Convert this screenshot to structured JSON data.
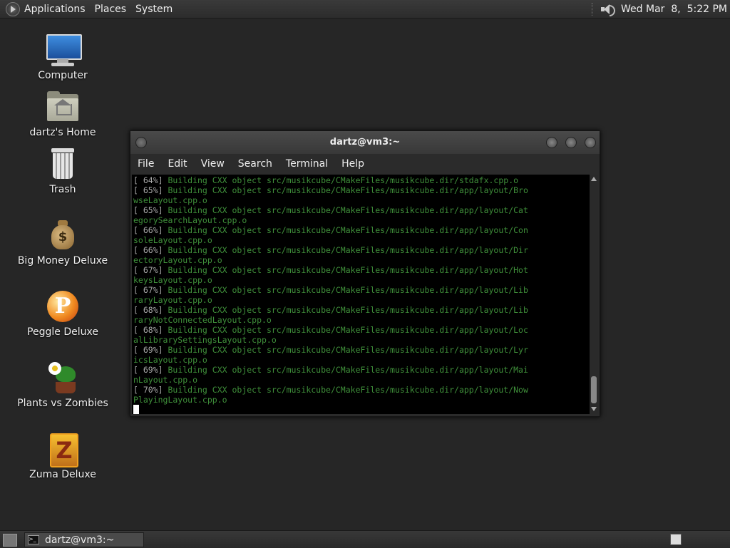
{
  "top_panel": {
    "menus": [
      "Applications",
      "Places",
      "System"
    ],
    "clock": "Wed Mar  8,  5:22 PM"
  },
  "desktop_icons": [
    {
      "label": "Computer",
      "icon": "computer-icon"
    },
    {
      "label": "dartz's Home",
      "icon": "home-folder-icon"
    },
    {
      "label": "Trash",
      "icon": "trash-icon"
    },
    {
      "label": "Big Money Deluxe",
      "icon": "money-bag-icon"
    },
    {
      "label": "Peggle Deluxe",
      "icon": "peggle-icon"
    },
    {
      "label": "Plants vs Zombies",
      "icon": "plants-icon"
    },
    {
      "label": "Zuma Deluxe",
      "icon": "zuma-icon"
    }
  ],
  "terminal": {
    "title": "dartz@vm3:~",
    "menu": [
      "File",
      "Edit",
      "View",
      "Search",
      "Terminal",
      "Help"
    ],
    "lines": [
      {
        "pct": "[ 64%]",
        "text": " Building CXX object src/musikcube/CMakeFiles/musikcube.dir/stdafx.cpp.o"
      },
      {
        "pct": "[ 65%]",
        "text": " Building CXX object src/musikcube/CMakeFiles/musikcube.dir/app/layout/Bro"
      },
      {
        "pct": "",
        "text": "wseLayout.cpp.o"
      },
      {
        "pct": "[ 65%]",
        "text": " Building CXX object src/musikcube/CMakeFiles/musikcube.dir/app/layout/Cat"
      },
      {
        "pct": "",
        "text": "egorySearchLayout.cpp.o"
      },
      {
        "pct": "[ 66%]",
        "text": " Building CXX object src/musikcube/CMakeFiles/musikcube.dir/app/layout/Con"
      },
      {
        "pct": "",
        "text": "soleLayout.cpp.o"
      },
      {
        "pct": "[ 66%]",
        "text": " Building CXX object src/musikcube/CMakeFiles/musikcube.dir/app/layout/Dir"
      },
      {
        "pct": "",
        "text": "ectoryLayout.cpp.o"
      },
      {
        "pct": "[ 67%]",
        "text": " Building CXX object src/musikcube/CMakeFiles/musikcube.dir/app/layout/Hot"
      },
      {
        "pct": "",
        "text": "keysLayout.cpp.o"
      },
      {
        "pct": "[ 67%]",
        "text": " Building CXX object src/musikcube/CMakeFiles/musikcube.dir/app/layout/Lib"
      },
      {
        "pct": "",
        "text": "raryLayout.cpp.o"
      },
      {
        "pct": "[ 68%]",
        "text": " Building CXX object src/musikcube/CMakeFiles/musikcube.dir/app/layout/Lib"
      },
      {
        "pct": "",
        "text": "raryNotConnectedLayout.cpp.o"
      },
      {
        "pct": "[ 68%]",
        "text": " Building CXX object src/musikcube/CMakeFiles/musikcube.dir/app/layout/Loc"
      },
      {
        "pct": "",
        "text": "alLibrarySettingsLayout.cpp.o"
      },
      {
        "pct": "[ 69%]",
        "text": " Building CXX object src/musikcube/CMakeFiles/musikcube.dir/app/layout/Lyr"
      },
      {
        "pct": "",
        "text": "icsLayout.cpp.o"
      },
      {
        "pct": "[ 69%]",
        "text": " Building CXX object src/musikcube/CMakeFiles/musikcube.dir/app/layout/Mai"
      },
      {
        "pct": "",
        "text": "nLayout.cpp.o"
      },
      {
        "pct": "[ 70%]",
        "text": " Building CXX object src/musikcube/CMakeFiles/musikcube.dir/app/layout/Now"
      },
      {
        "pct": "",
        "text": "PlayingLayout.cpp.o"
      }
    ]
  },
  "taskbar": {
    "window_label": "dartz@vm3:~"
  },
  "colors": {
    "terminal_text": "#3f8f3a",
    "desktop_bg": "#262626"
  }
}
